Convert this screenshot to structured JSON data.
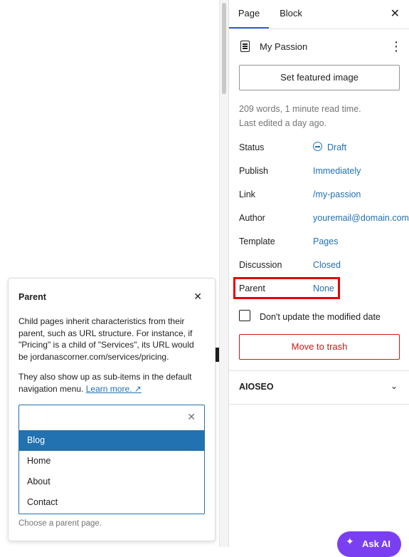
{
  "sidebar": {
    "tabs": {
      "page": "Page",
      "block": "Block",
      "close": "✕"
    },
    "document": {
      "title": "My Passion",
      "more": "⋮"
    },
    "featured_image_button": "Set featured image",
    "meta": {
      "words": "209 words, 1 minute read time.",
      "edited": "Last edited a day ago."
    },
    "fields": {
      "status": {
        "label": "Status",
        "value": "Draft"
      },
      "publish": {
        "label": "Publish",
        "value": "Immediately"
      },
      "link": {
        "label": "Link",
        "value": "/my-passion"
      },
      "author": {
        "label": "Author",
        "value": "youremail@domain.com"
      },
      "template": {
        "label": "Template",
        "value": "Pages"
      },
      "discussion": {
        "label": "Discussion",
        "value": "Closed"
      },
      "parent": {
        "label": "Parent",
        "value": "None"
      }
    },
    "checkbox_label": "Don't update the modified date",
    "trash_button": "Move to trash",
    "aioseo": {
      "label": "AIOSEO",
      "chevron": "⌄"
    },
    "ask_ai": {
      "label": "Ask AI"
    }
  },
  "popover": {
    "title": "Parent",
    "close": "✕",
    "description": "Child pages inherit characteristics from their parent, such as URL structure. For instance, if \"Pricing\" is a child of \"Services\", its URL would be jordanascorner.com/services/pricing.",
    "description2": "They also show up as sub-items in the default navigation menu.",
    "learn_more": "Learn more. ↗",
    "combobox": {
      "value": "",
      "clear": "✕"
    },
    "options": [
      "Blog",
      "Home",
      "About",
      "Contact"
    ],
    "selected_option": "Blog",
    "help": "Choose a parent page."
  },
  "colors": {
    "accent": "#2271b1",
    "danger": "#cc1818",
    "highlight": "#e60000",
    "tab_indicator": "#3858e9",
    "ask_ai": "#7b3ff2"
  }
}
